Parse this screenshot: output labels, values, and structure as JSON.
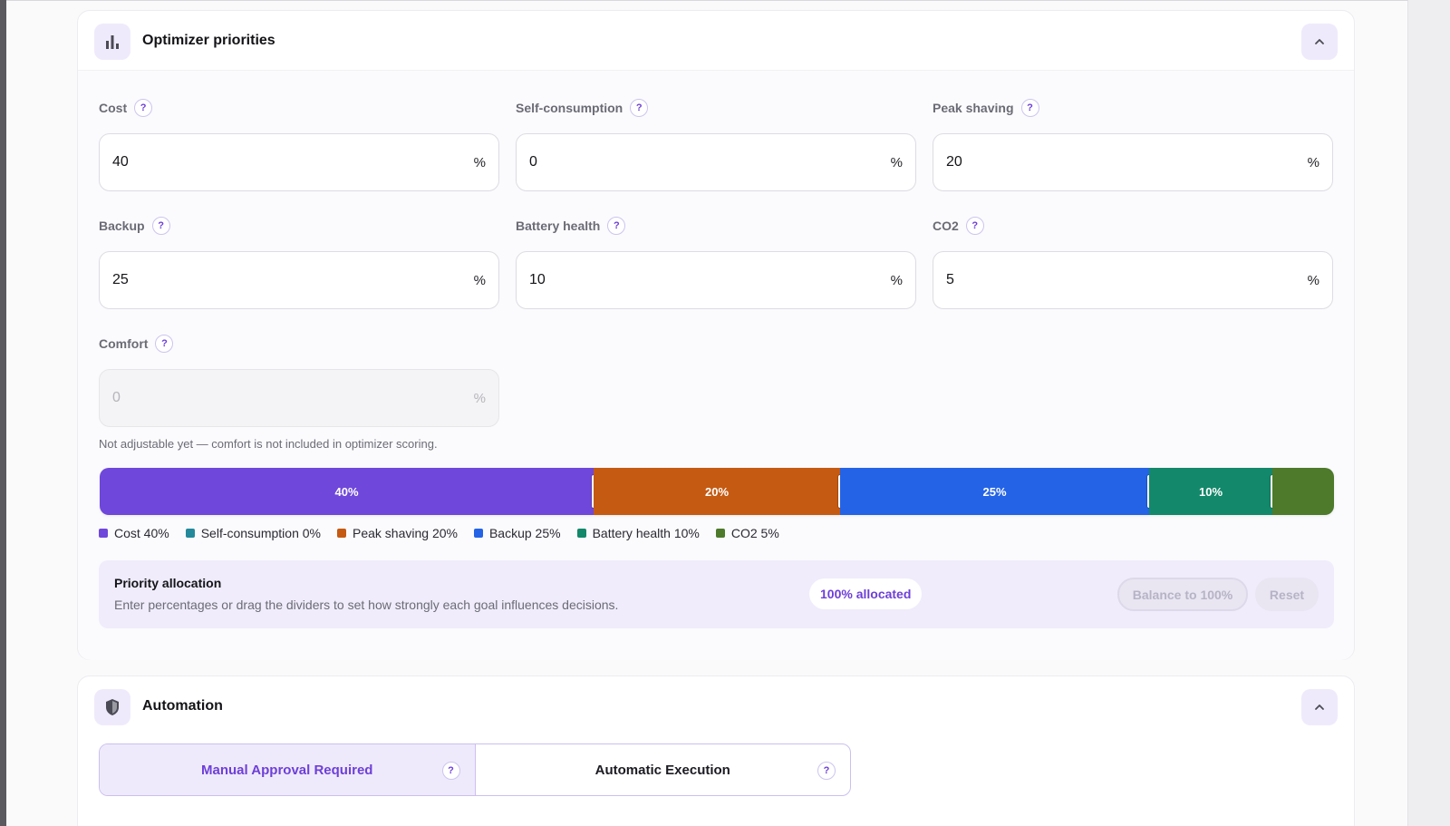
{
  "colors": {
    "accent": "#6d3fd9",
    "cost": "#6f47db",
    "self_consumption": "#23899b",
    "peak_shaving": "#c55a12",
    "backup": "#2463e6",
    "battery_health": "#13886b",
    "co2": "#4d7a2b"
  },
  "priorities": {
    "title": "Optimizer priorities",
    "icon": "bar-chart-icon",
    "collapse_icon": "chevron-up-icon",
    "help_glyph": "?",
    "pct_unit": "%",
    "fields": {
      "cost": {
        "label": "Cost",
        "value": "40"
      },
      "self_consumption": {
        "label": "Self-consumption",
        "value": "0"
      },
      "peak_shaving": {
        "label": "Peak shaving",
        "value": "20"
      },
      "backup": {
        "label": "Backup",
        "value": "25"
      },
      "battery_health": {
        "label": "Battery health",
        "value": "10"
      },
      "co2": {
        "label": "CO2",
        "value": "5"
      },
      "comfort": {
        "label": "Comfort",
        "value": "0"
      }
    },
    "comfort_hint": "Not adjustable yet — comfort is not included in optimizer scoring.",
    "bar": {
      "segments": [
        {
          "key": "cost",
          "value": 40,
          "label": "40%"
        },
        {
          "key": "peak_shaving",
          "value": 20,
          "label": "20%"
        },
        {
          "key": "backup",
          "value": 25,
          "label": "25%"
        },
        {
          "key": "battery_health",
          "value": 10,
          "label": "10%"
        },
        {
          "key": "co2",
          "value": 5,
          "label": ""
        }
      ]
    },
    "legend": [
      {
        "key": "cost",
        "text": "Cost 40%"
      },
      {
        "key": "self_consumption",
        "text": "Self-consumption 0%"
      },
      {
        "key": "peak_shaving",
        "text": "Peak shaving 20%"
      },
      {
        "key": "backup",
        "text": "Backup 25%"
      },
      {
        "key": "battery_health",
        "text": "Battery health 10%"
      },
      {
        "key": "co2",
        "text": "CO2 5%"
      }
    ],
    "allocation": {
      "title": "Priority allocation",
      "subtitle": "Enter percentages or drag the dividers to set how strongly each goal influences decisions.",
      "status": "100% allocated",
      "balance_label": "Balance to 100%",
      "reset_label": "Reset"
    }
  },
  "automation": {
    "title": "Automation",
    "icon": "shield-icon",
    "collapse_icon": "chevron-up-icon",
    "modes": [
      {
        "label": "Manual Approval Required",
        "selected": true
      },
      {
        "label": "Automatic Execution",
        "selected": false
      }
    ]
  }
}
